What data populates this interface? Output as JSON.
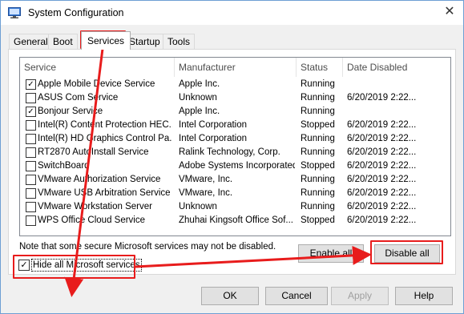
{
  "window": {
    "title": "System Configuration",
    "close_glyph": "✕"
  },
  "tabs": [
    {
      "label": "General"
    },
    {
      "label": "Boot"
    },
    {
      "label": "Services",
      "active": true
    },
    {
      "label": "Startup"
    },
    {
      "label": "Tools"
    }
  ],
  "services": {
    "columns": {
      "service": "Service",
      "manufacturer": "Manufacturer",
      "status": "Status",
      "date_disabled": "Date Disabled"
    },
    "rows": [
      {
        "checked": true,
        "service": "Apple Mobile Device Service",
        "manufacturer": "Apple Inc.",
        "status": "Running",
        "date": ""
      },
      {
        "checked": false,
        "service": "ASUS Com Service",
        "manufacturer": "Unknown",
        "status": "Running",
        "date": "6/20/2019 2:22..."
      },
      {
        "checked": true,
        "service": "Bonjour Service",
        "manufacturer": "Apple Inc.",
        "status": "Running",
        "date": ""
      },
      {
        "checked": false,
        "service": "Intel(R) Content Protection HEC...",
        "manufacturer": "Intel Corporation",
        "status": "Stopped",
        "date": "6/20/2019 2:22..."
      },
      {
        "checked": false,
        "service": "Intel(R) HD Graphics Control Pa...",
        "manufacturer": "Intel Corporation",
        "status": "Running",
        "date": "6/20/2019 2:22..."
      },
      {
        "checked": false,
        "service": "RT2870 AutoInstall Service",
        "manufacturer": "Ralink Technology, Corp.",
        "status": "Running",
        "date": "6/20/2019 2:22..."
      },
      {
        "checked": false,
        "service": "SwitchBoard",
        "manufacturer": "Adobe Systems Incorporated",
        "status": "Stopped",
        "date": "6/20/2019 2:22..."
      },
      {
        "checked": false,
        "service": "VMware Authorization Service",
        "manufacturer": "VMware, Inc.",
        "status": "Running",
        "date": "6/20/2019 2:22..."
      },
      {
        "checked": false,
        "service": "VMware USB Arbitration Service",
        "manufacturer": "VMware, Inc.",
        "status": "Running",
        "date": "6/20/2019 2:22..."
      },
      {
        "checked": false,
        "service": "VMware Workstation Server",
        "manufacturer": "Unknown",
        "status": "Running",
        "date": "6/20/2019 2:22..."
      },
      {
        "checked": false,
        "service": "WPS Office Cloud Service",
        "manufacturer": "Zhuhai Kingsoft Office Sof...",
        "status": "Stopped",
        "date": "6/20/2019 2:22..."
      }
    ]
  },
  "note": "Note that some secure Microsoft services may not be disabled.",
  "hide_ms": {
    "label": "Hide all Microsoft services",
    "checked": true
  },
  "buttons": {
    "enable_all": "Enable all",
    "disable_all": "Disable all",
    "ok": "OK",
    "cancel": "Cancel",
    "apply": "Apply",
    "help": "Help"
  },
  "colors": {
    "highlight": "#e81c1c",
    "title_border": "#6e9fd4"
  },
  "icons": {
    "app": "system-configuration-icon",
    "check": "✓"
  }
}
